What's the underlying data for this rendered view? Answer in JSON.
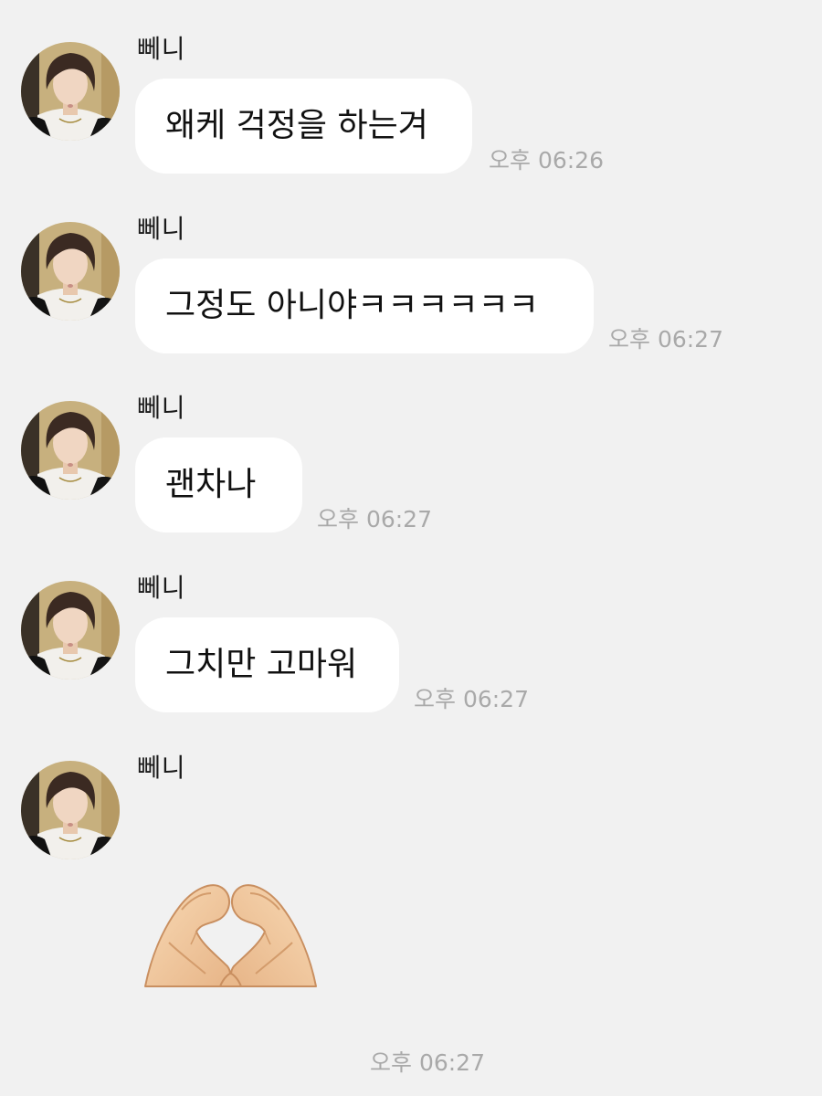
{
  "sender_name": "뻬니",
  "messages": [
    {
      "text": "왜케 걱정을 하는겨",
      "time": "오후 06:26"
    },
    {
      "text": "그정도 아니야ㅋㅋㅋㅋㅋㅋ",
      "time": "오후 06:27"
    },
    {
      "text": "괜차나",
      "time": "오후 06:27"
    },
    {
      "text": "그치만 고마워",
      "time": "오후 06:27"
    },
    {
      "emoji": "heart-hands",
      "time": "오후 06:27"
    }
  ],
  "colors": {
    "background": "#f1f1f1",
    "bubble": "#ffffff",
    "timestamp": "#a9a9a9"
  }
}
